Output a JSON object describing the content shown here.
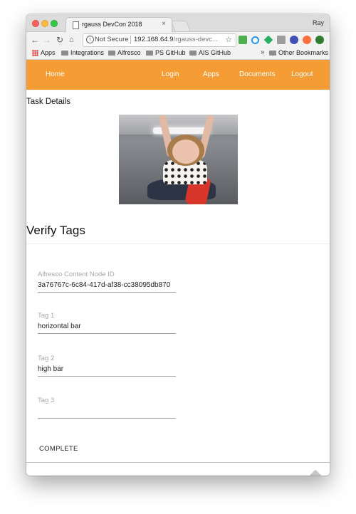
{
  "browser": {
    "tab_title": "rgauss DevCon 2018",
    "tab_close": "×",
    "user": "Ray",
    "security": "Not Secure",
    "url_host": "192.168.64.9",
    "url_rest": "/rgauss-devc...",
    "back": "←",
    "forward": "→",
    "reload": "C",
    "home": "⌂",
    "star": "☆",
    "info": "i"
  },
  "bookmarks": {
    "items": [
      "Apps",
      "Integrations",
      "Alfresco",
      "PS GitHub",
      "AIS GitHub"
    ],
    "overflow": "»",
    "other": "Other Bookmarks"
  },
  "nav": {
    "home": "Home",
    "login": "Login",
    "apps": "Apps",
    "documents": "Documents",
    "logout": "Logout"
  },
  "task": {
    "heading": "Task Details",
    "form_title": "Verify Tags",
    "fields": [
      {
        "label": "Alfresco Content Node ID",
        "value": "3a76767c-6c84-417d-af38-cc38095db870"
      },
      {
        "label": "Tag 1",
        "value": "horizontal bar"
      },
      {
        "label": "Tag 2",
        "value": "high bar"
      },
      {
        "label": "Tag 3",
        "value": ""
      }
    ],
    "complete_label": "COMPLETE"
  },
  "colors": {
    "appbar": "#f59c34"
  }
}
